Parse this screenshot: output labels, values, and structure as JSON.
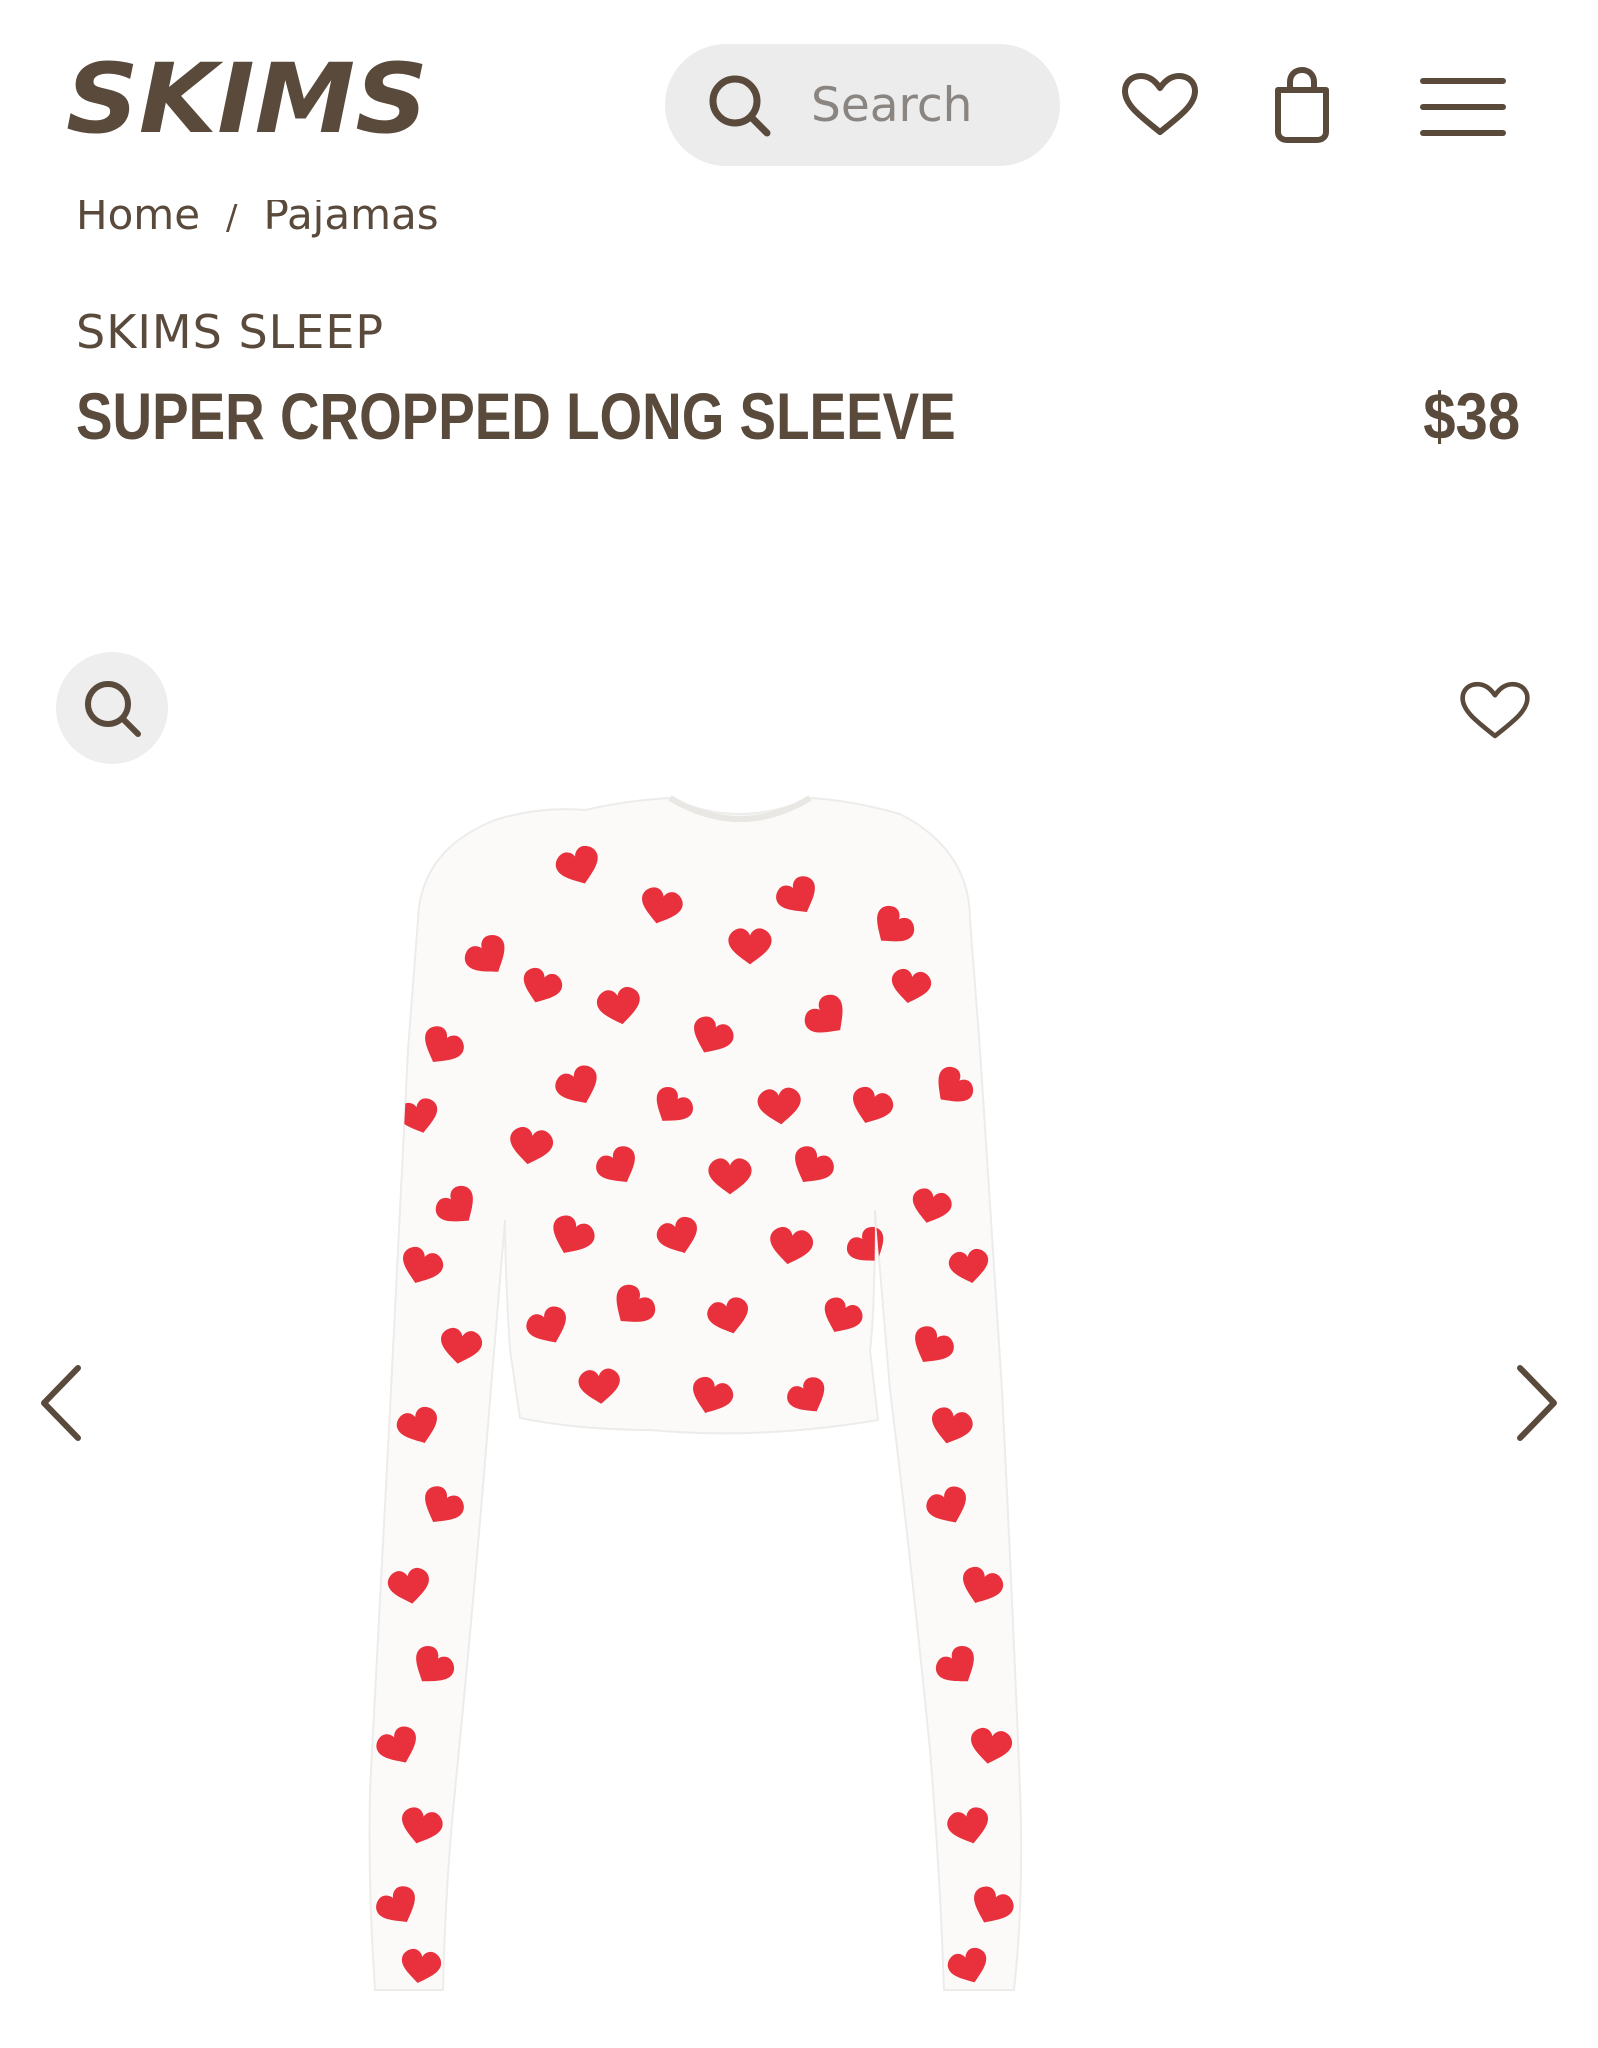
{
  "header": {
    "logo_text": "SKIMS",
    "search": {
      "placeholder": "Search"
    },
    "icons": [
      "search-icon",
      "heart-icon",
      "shopping-bag-icon",
      "menu-icon"
    ]
  },
  "breadcrumb": {
    "items": [
      "Home",
      "Pajamas"
    ],
    "separator": "/"
  },
  "product": {
    "brand": "SKIMS SLEEP",
    "name": "SUPER CROPPED LONG SLEEVE",
    "price": "$38",
    "gallery_icons": [
      "zoom-icon",
      "wishlist-heart-icon",
      "chevron-left-icon",
      "chevron-right-icon"
    ]
  },
  "colors": {
    "brand_brown": "#5a4a3c",
    "heart_red": "#e8313c",
    "search_bg": "#ececec"
  }
}
